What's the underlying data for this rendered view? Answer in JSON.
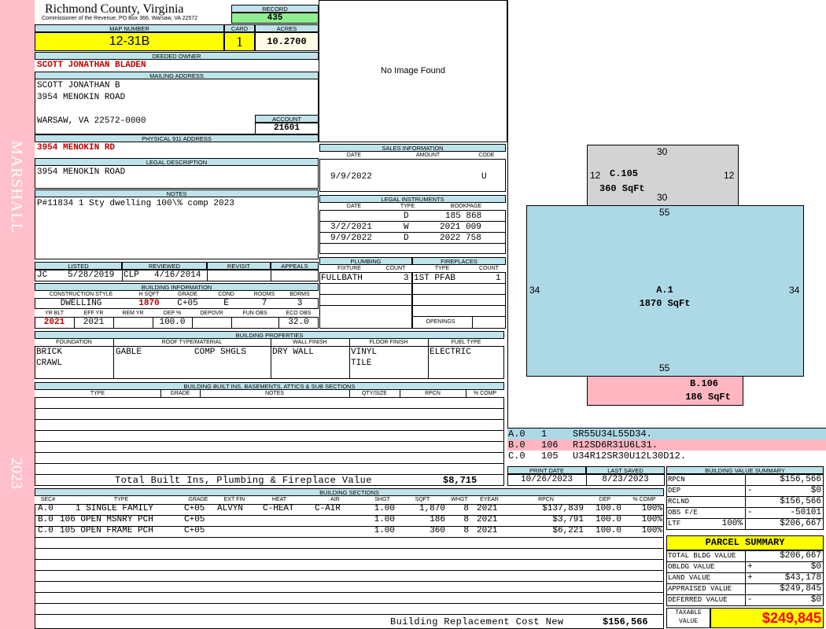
{
  "side": {
    "district": "MARSHALL",
    "year": "2023"
  },
  "header": {
    "county": "Richmond County, Virginia",
    "commissioner": "Commissioner of the Revenue, PO Box 366, Warsaw, VA 22572",
    "record_label": "RECORD",
    "record": "435",
    "map_label": "MAP NUMBER",
    "map_number": "12-31B",
    "card_label": "CARD",
    "card": "1",
    "acres_label": "ACRES",
    "acres": "10.2700"
  },
  "owner": {
    "deeded_label": "DEEDED OWNER",
    "deeded": "SCOTT JONATHAN BLADEN",
    "mailing_label": "MAILING ADDRESS",
    "mail1": "SCOTT JONATHAN B",
    "mail2": "3954 MENOKIN ROAD",
    "mail3": "WARSAW, VA 22572-0000",
    "account_label": "ACCOUNT",
    "account": "21601",
    "physical_label": "PHYSICAL 911 ADDRESS",
    "physical": "3954 MENOKIN RD",
    "legal_label": "LEGAL DESCRIPTION",
    "legal": "3954 MENOKIN ROAD",
    "notes_label": "NOTES",
    "notes": "P#11834 1 Sty dwelling 100\\% comp 2023"
  },
  "image": {
    "text": "No Image Found"
  },
  "sales": {
    "title": "SALES INFORMATION",
    "h_date": "DATE",
    "h_amount": "AMOUNT",
    "h_code": "CODE",
    "date": "9/9/2022",
    "code": "U"
  },
  "legal_instr": {
    "title": "LEGAL INSTRUMENTS",
    "h_date": "DATE",
    "h_type": "TYPE",
    "h_bookpage": "BOOKPAGE",
    "rows": [
      {
        "date": "",
        "type": "D",
        "bp": "185 868"
      },
      {
        "date": "3/2/2021",
        "type": "W",
        "bp": "2021 009"
      },
      {
        "date": "9/9/2022",
        "type": "D",
        "bp": "2022 758"
      }
    ]
  },
  "plumbing": {
    "title": "PLUMBING",
    "h_fixture": "FIXTURE",
    "h_count": "COUNT",
    "fixture": "FULLBATH",
    "count": "3"
  },
  "fireplaces": {
    "title": "FIREPLACES",
    "h_type": "TYPE",
    "h_count": "COUNT",
    "type": "1ST PFAB",
    "count": "1",
    "openings": "OPENINGS"
  },
  "review": {
    "h_listed": "LISTED",
    "h_reviewed": "REVIEWED",
    "h_revisit": "REVISIT",
    "h_appeals": "APPEALS",
    "listed_by": "JC",
    "listed_date": "5/28/2019",
    "reviewed_by": "CLP",
    "reviewed_date": "4/16/2014"
  },
  "building_info": {
    "title": "BUILDING INFORMATION",
    "h_style": "CONSTRUCTION STYLE",
    "h_hsqft": "H SQFT",
    "h_grade": "GRADE",
    "h_cond": "COND",
    "h_rooms": "ROOMS",
    "h_bdrms": "BDRMS",
    "style": "DWELLING",
    "hsqft": "1870",
    "grade": "C+05",
    "cond": "E",
    "rooms": "7",
    "bdrms": "3",
    "h_yrblt": "YR BLT",
    "h_effyr": "EFF YR",
    "h_remyr": "REM YR",
    "h_dep": "DEP %",
    "h_depovr": "DEPOVR",
    "h_funobs": "FUN OBS",
    "h_ecoobs": "ECO OBS",
    "yrblt": "2021",
    "effyr": "2021",
    "dep": "100.0",
    "ecoobs": "32.0"
  },
  "props": {
    "title": "BUILDING PROPERTIES",
    "h_found": "FOUNDATION",
    "h_roof": "ROOF TYPE/MATERIAL",
    "h_wall": "WALL FINISH",
    "h_floor": "FLOOR FINISH",
    "h_fuel": "FUEL TYPE",
    "found1": "BRICK",
    "found2": "CRAWL",
    "roof_type": "GABLE",
    "roof_mat": "COMP SHGLS",
    "wall": "DRY WALL",
    "floor1": "VINYL",
    "floor2": "TILE",
    "fuel": "ELECTRIC"
  },
  "builtins": {
    "title": "BUILDING BUILT INS, BASEMENTS, ATTICS & SUB SECTIONS",
    "h_type": "TYPE",
    "h_grade": "GRADE",
    "h_notes": "NOTES",
    "h_qty": "QTY/SIZE",
    "h_rpcn": "RPCN",
    "h_comp": "% COMP",
    "total_label": "Total Built Ins, Plumbing & Fireplace Value",
    "total": "$8,715"
  },
  "sketch": {
    "c_top": "30",
    "c_left": "12",
    "c_right": "12",
    "c_name": "C.105",
    "c_area": "360 SqFt",
    "c_bottom": "30",
    "a_top": "55",
    "a_left": "34",
    "a_right": "34",
    "a_name": "A.1",
    "a_area": "1870 SqFt",
    "a_bottom": "55",
    "b_name": "B.106",
    "b_area": "186 SqFt",
    "colors": {
      "c": "#d3d3d3",
      "a": "#add8e6",
      "b": "#ffb6c1"
    }
  },
  "vectors": [
    {
      "sec": "A.0",
      "code": "1",
      "vec": "SR55U34L55D34."
    },
    {
      "sec": "B.0",
      "code": "106",
      "vec": "R12SD6R31U6L31."
    },
    {
      "sec": "C.0",
      "code": "105",
      "vec": "U34R12SR30U12L30D12."
    }
  ],
  "dates": {
    "print_label": "PRINT DATE",
    "print": "10/26/2023",
    "saved_label": "LAST SAVED",
    "saved": "8/23/2023"
  },
  "value_summary": {
    "title": "BUILDING VALUE SUMMARY",
    "rows": [
      {
        "label": "RPCN",
        "sign": "",
        "pct": "",
        "value": "$156,566"
      },
      {
        "label": "DEP",
        "sign": "-",
        "pct": "",
        "value": "$0"
      },
      {
        "label": "RCLND",
        "sign": "",
        "pct": "",
        "value": "$156,566"
      },
      {
        "label": "OBS F/E",
        "sign": "-",
        "pct": "",
        "value": "-50101"
      },
      {
        "label": "LTF",
        "sign": "",
        "pct": "100%",
        "value": "$206,667"
      }
    ]
  },
  "parcel": {
    "title": "PARCEL SUMMARY",
    "rows": [
      {
        "label": "TOTAL BLDG VALUE",
        "sign": "",
        "value": "$206,667"
      },
      {
        "label": "OBLDG VALUE",
        "sign": "+",
        "value": "$0"
      },
      {
        "label": "LAND VALUE",
        "sign": "+",
        "value": "$43,178"
      },
      {
        "label": "APPRAISED VALUE",
        "sign": "",
        "value": "$249,845"
      },
      {
        "label": "DEFERRED VALUE",
        "sign": "-",
        "value": "$0"
      }
    ],
    "taxable_label1": "TAXABLE",
    "taxable_label2": "VALUE",
    "taxable": "$249,845"
  },
  "sections": {
    "title": "BUILDING SECTIONS",
    "headers": {
      "sec": "SEC#",
      "type": "TYPE",
      "grade": "GRADE",
      "extfin": "EXT FIN",
      "heat": "HEAT",
      "air": "AIR",
      "shgt": "SHGT",
      "sqft": "SQFT",
      "whgt": "WHGT",
      "eyear": "EYEAR",
      "rpcn": "RPCN",
      "dep": "DEP",
      "comp": "% COMP"
    },
    "rows": [
      {
        "sec": "A.0",
        "type": "1 SINGLE FAMILY",
        "grade": "C+05",
        "extfin": "ALVYN",
        "heat": "C-HEAT",
        "air": "C-AIR",
        "shgt": "1.00",
        "sqft": "1,870",
        "whgt": "8",
        "eyear": "2021",
        "rpcn": "$137,839",
        "dep": "100.0",
        "comp": "100%"
      },
      {
        "sec": "B.0",
        "type": "106 OPEN MSNRY PCH",
        "grade": "C+05",
        "extfin": "",
        "heat": "",
        "air": "",
        "shgt": "1.00",
        "sqft": "186",
        "whgt": "8",
        "eyear": "2021",
        "rpcn": "$3,791",
        "dep": "100.0",
        "comp": "100%"
      },
      {
        "sec": "C.0",
        "type": "105 OPEN FRAME PCH",
        "grade": "C+05",
        "extfin": "",
        "heat": "",
        "air": "",
        "shgt": "1.00",
        "sqft": "360",
        "whgt": "8",
        "eyear": "2021",
        "rpcn": "$6,221",
        "dep": "100.0",
        "comp": "100%"
      }
    ],
    "replacement_label": "Building Replacement Cost New",
    "replacement": "$156,566"
  }
}
